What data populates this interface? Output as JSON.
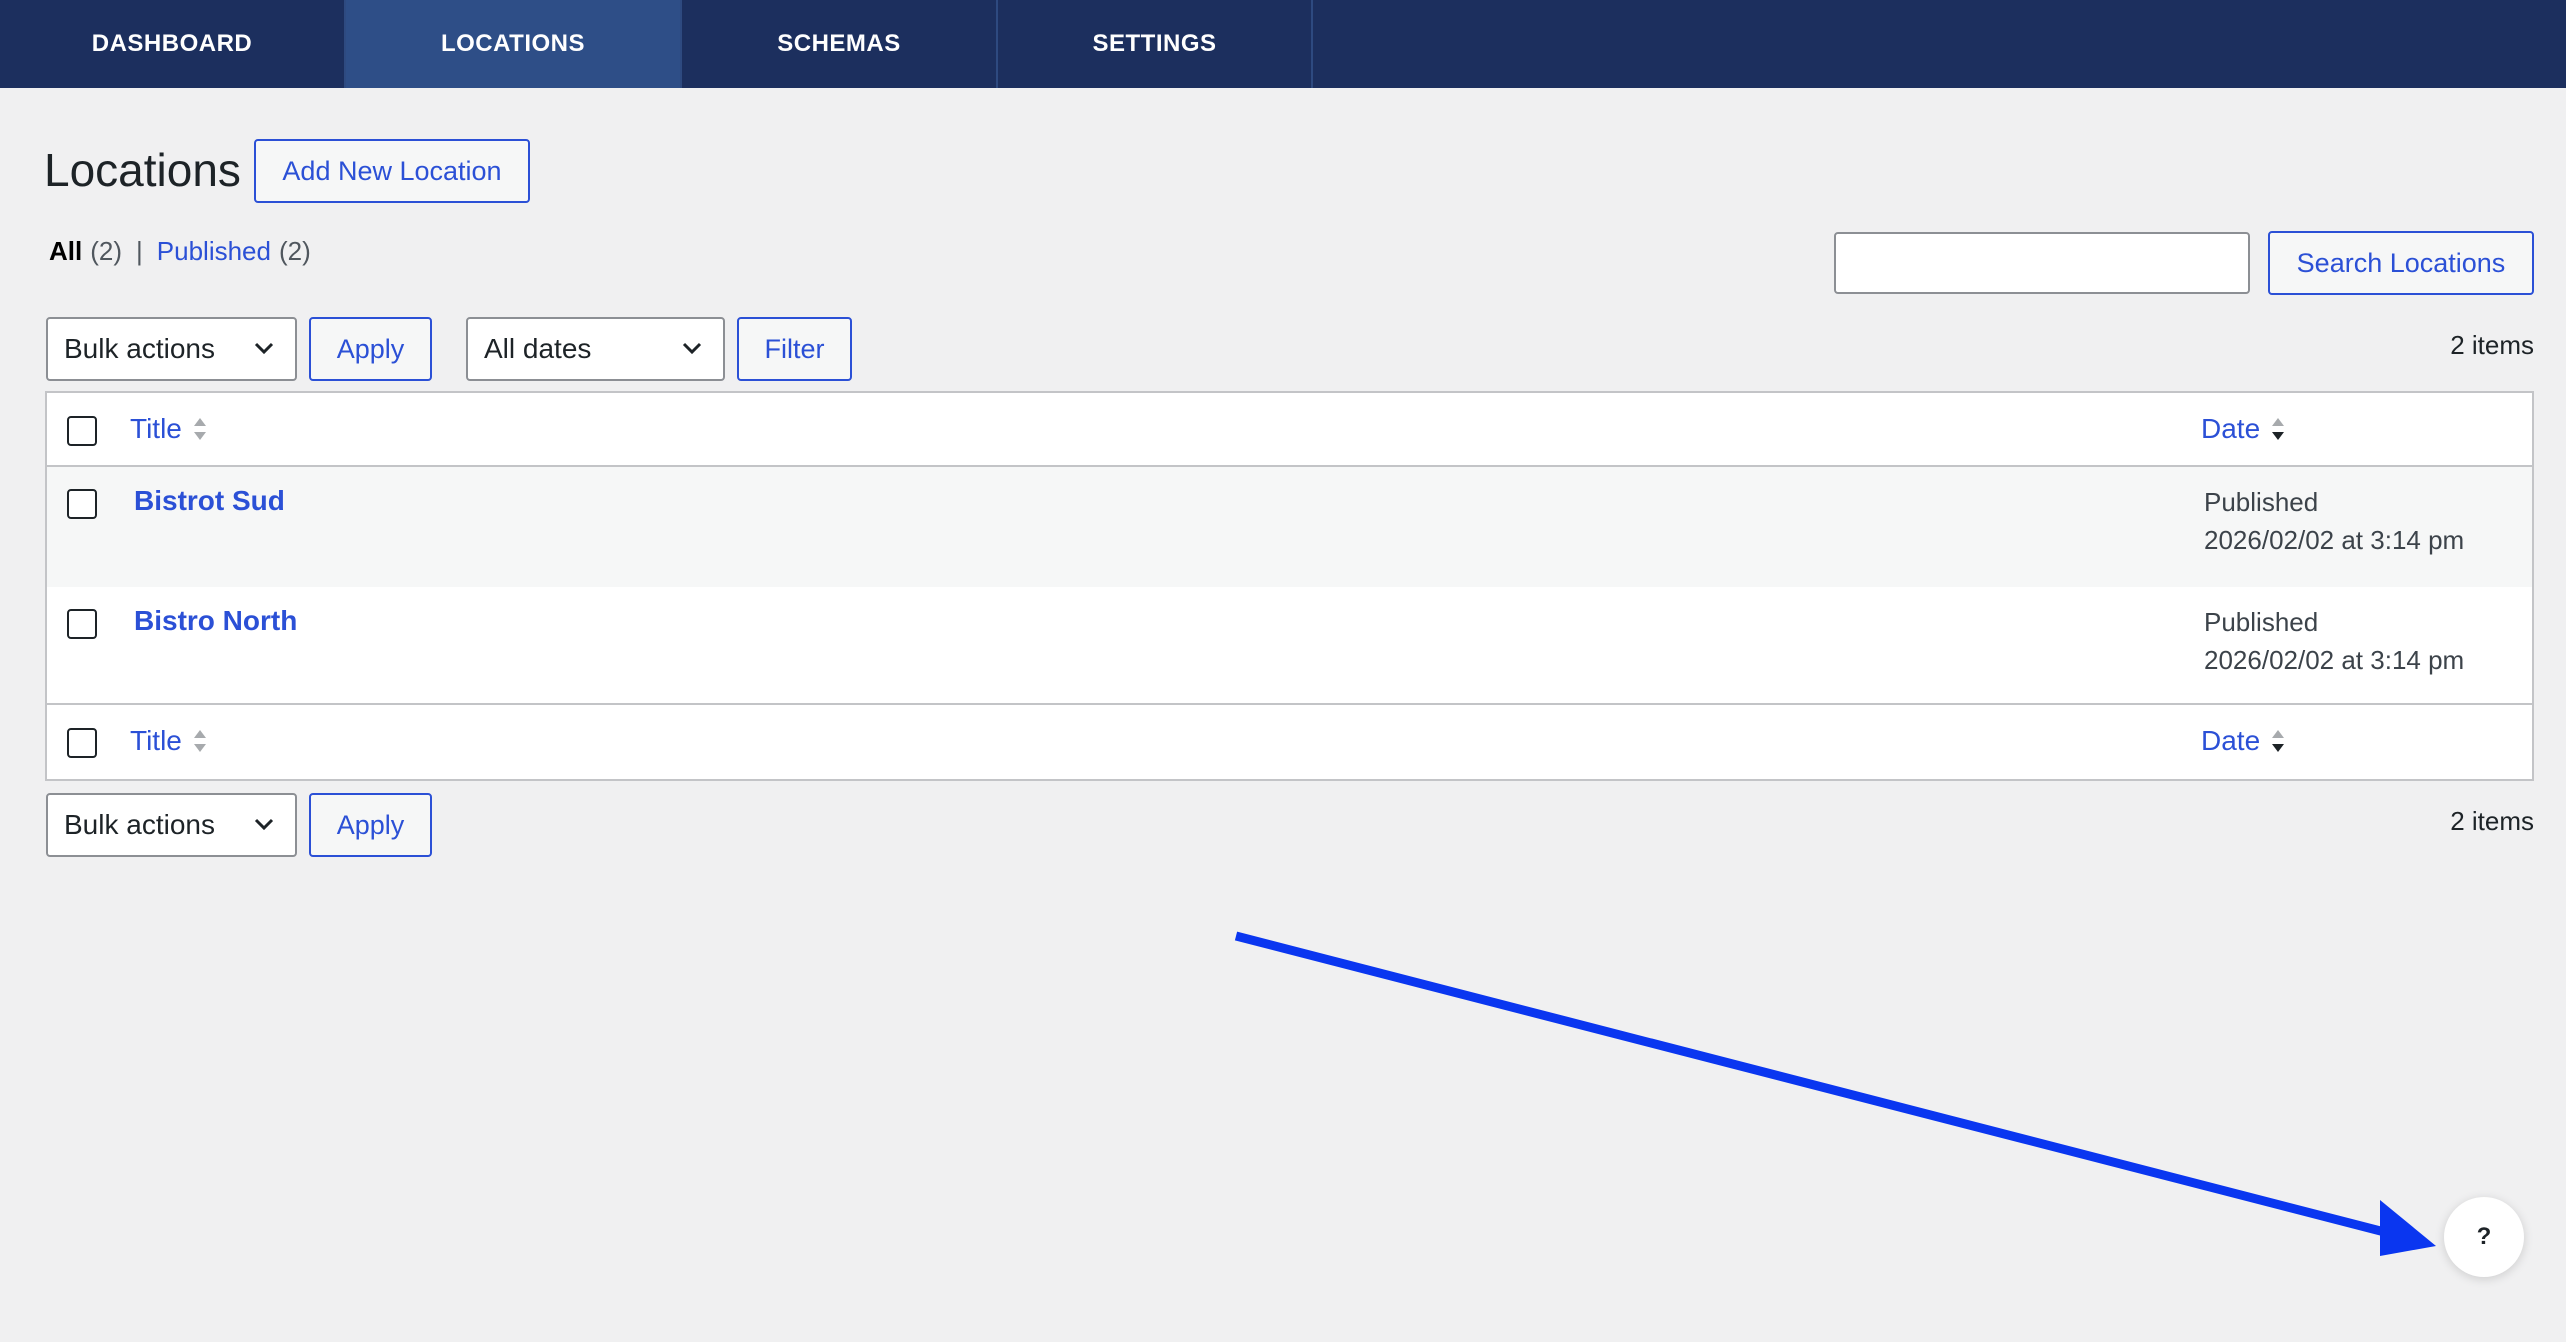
{
  "nav": {
    "tabs": [
      {
        "label": "DASHBOARD",
        "active": false
      },
      {
        "label": "LOCATIONS",
        "active": true
      },
      {
        "label": "SCHEMAS",
        "active": false
      },
      {
        "label": "SETTINGS",
        "active": false
      }
    ]
  },
  "header": {
    "title": "Locations",
    "add_new_label": "Add New Location"
  },
  "views": {
    "all_label": "All",
    "all_count": "(2)",
    "separator": "|",
    "published_label": "Published",
    "published_count": "(2)"
  },
  "search": {
    "value": "",
    "button_label": "Search Locations"
  },
  "toolbar_top": {
    "bulk_actions": "Bulk actions",
    "apply_label": "Apply",
    "dates": "All dates",
    "filter_label": "Filter",
    "items_count": "2 items"
  },
  "table": {
    "columns": {
      "title": "Title",
      "date": "Date"
    },
    "rows": [
      {
        "title": "Bistrot Sud",
        "status": "Published",
        "date": "2026/02/02 at 3:14 pm"
      },
      {
        "title": "Bistro North",
        "status": "Published",
        "date": "2026/02/02 at 3:14 pm"
      }
    ]
  },
  "toolbar_bottom": {
    "bulk_actions": "Bulk actions",
    "apply_label": "Apply",
    "items_count": "2 items"
  },
  "help": {
    "label": "?"
  },
  "colors": {
    "nav_bg": "#1c2f5e",
    "nav_active": "#2e4e87",
    "accent": "#2b50d6",
    "annotation_arrow": "#0a36f0",
    "page_bg": "#f0f0f1"
  },
  "icons": [
    "chevron-down-icon",
    "sort-icon",
    "help-icon",
    "annotation-arrow"
  ]
}
